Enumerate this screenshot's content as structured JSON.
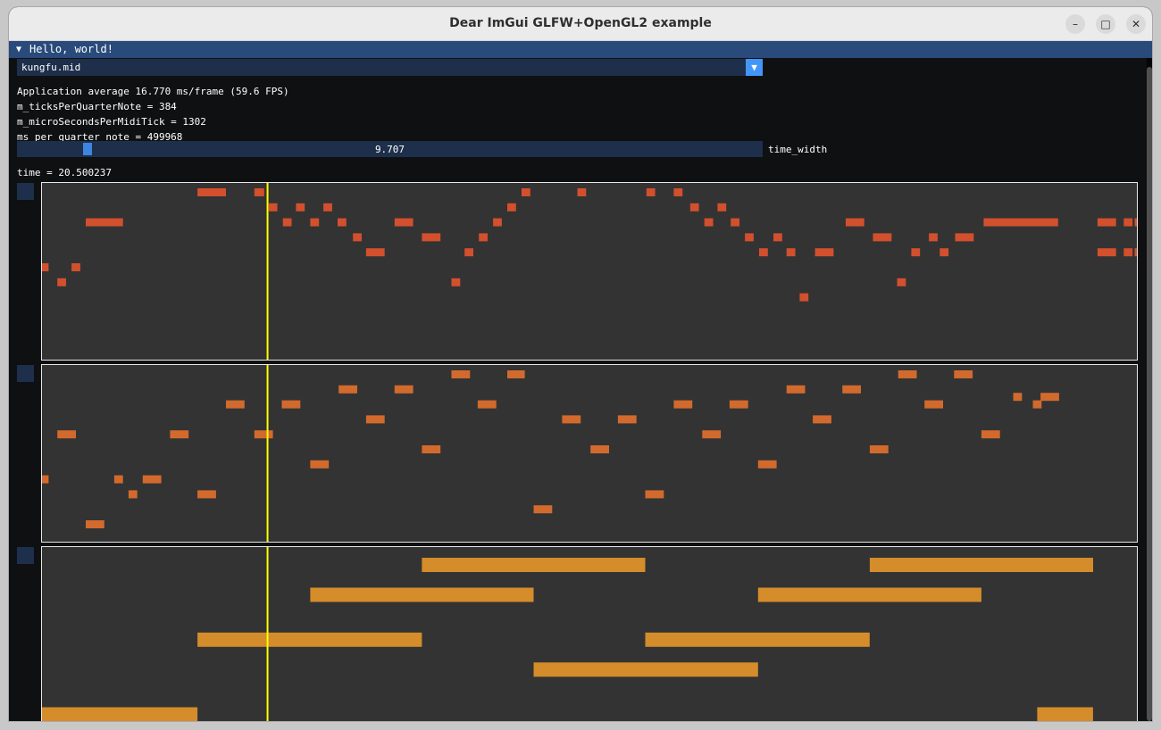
{
  "window": {
    "title": "Dear ImGui GLFW+OpenGL2 example",
    "controls": [
      "minimize-icon",
      "maximize-icon",
      "close-icon"
    ]
  },
  "imgui": {
    "window_title": "Hello, world!",
    "combo_value": "kungfu.mid",
    "stats": [
      "Application average 16.770 ms/frame (59.6 FPS)",
      "m_ticksPerQuarterNote = 384",
      "m_microSecondsPerMidiTick = 1302",
      "ms per quarter note = 499968"
    ],
    "slider": {
      "value_text": "9.707",
      "label": "time_width",
      "fraction": 0.09
    },
    "time_text": "time = 20.500237"
  },
  "colors": {
    "track1": "#d2502d",
    "track2": "#d26a2d",
    "track3": "#d58c2a",
    "playhead": "#ffff00",
    "accent": "#4296fa"
  },
  "playhead_time": 0.206,
  "tracks": [
    {
      "color": "#d2502d",
      "lanes": 11,
      "notes": [
        [
          0.142,
          0.168,
          0
        ],
        [
          0.194,
          0.203,
          0
        ],
        [
          0.438,
          0.446,
          0
        ],
        [
          0.489,
          0.497,
          0
        ],
        [
          0.552,
          0.56,
          0
        ],
        [
          0.577,
          0.585,
          0
        ],
        [
          0.207,
          0.215,
          1
        ],
        [
          0.232,
          0.24,
          1
        ],
        [
          0.257,
          0.265,
          1
        ],
        [
          0.425,
          0.433,
          1
        ],
        [
          0.592,
          0.6,
          1
        ],
        [
          0.617,
          0.625,
          1
        ],
        [
          0.04,
          0.074,
          2
        ],
        [
          0.22,
          0.228,
          2
        ],
        [
          0.245,
          0.253,
          2
        ],
        [
          0.27,
          0.278,
          2
        ],
        [
          0.322,
          0.339,
          2
        ],
        [
          0.412,
          0.42,
          2
        ],
        [
          0.605,
          0.613,
          2
        ],
        [
          0.629,
          0.637,
          2
        ],
        [
          0.734,
          0.751,
          2
        ],
        [
          0.86,
          0.928,
          2
        ],
        [
          0.964,
          0.981,
          2
        ],
        [
          0.988,
          0.996,
          2
        ],
        [
          0.998,
          1.0,
          2
        ],
        [
          0.284,
          0.292,
          3
        ],
        [
          0.347,
          0.364,
          3
        ],
        [
          0.399,
          0.407,
          3
        ],
        [
          0.642,
          0.65,
          3
        ],
        [
          0.668,
          0.676,
          3
        ],
        [
          0.759,
          0.776,
          3
        ],
        [
          0.81,
          0.818,
          3
        ],
        [
          0.834,
          0.851,
          3
        ],
        [
          0.296,
          0.313,
          4
        ],
        [
          0.386,
          0.394,
          4
        ],
        [
          0.655,
          0.663,
          4
        ],
        [
          0.68,
          0.688,
          4
        ],
        [
          0.706,
          0.723,
          4
        ],
        [
          0.794,
          0.802,
          4
        ],
        [
          0.82,
          0.828,
          4
        ],
        [
          0.964,
          0.981,
          4
        ],
        [
          0.988,
          0.996,
          4
        ],
        [
          0.998,
          1.0,
          4
        ],
        [
          0.0,
          0.006,
          5
        ],
        [
          0.027,
          0.035,
          5
        ],
        [
          0.014,
          0.022,
          6
        ],
        [
          0.374,
          0.382,
          6
        ],
        [
          0.781,
          0.789,
          6
        ],
        [
          0.692,
          0.7,
          7
        ]
      ]
    },
    {
      "color": "#d26a2d",
      "lanes": 11,
      "notes": [
        [
          0.374,
          0.391,
          0
        ],
        [
          0.425,
          0.441,
          0
        ],
        [
          0.782,
          0.799,
          0
        ],
        [
          0.833,
          0.85,
          0
        ],
        [
          0.271,
          0.288,
          1
        ],
        [
          0.322,
          0.339,
          1
        ],
        [
          0.68,
          0.697,
          1
        ],
        [
          0.731,
          0.748,
          1
        ],
        [
          0.887,
          0.895,
          1.5
        ],
        [
          0.912,
          0.929,
          1.5
        ],
        [
          0.168,
          0.185,
          2
        ],
        [
          0.219,
          0.236,
          2
        ],
        [
          0.398,
          0.415,
          2
        ],
        [
          0.577,
          0.594,
          2
        ],
        [
          0.628,
          0.645,
          2
        ],
        [
          0.806,
          0.823,
          2
        ],
        [
          0.905,
          0.913,
          2
        ],
        [
          0.296,
          0.313,
          3
        ],
        [
          0.475,
          0.492,
          3
        ],
        [
          0.526,
          0.543,
          3
        ],
        [
          0.704,
          0.721,
          3
        ],
        [
          0.014,
          0.031,
          4
        ],
        [
          0.117,
          0.134,
          4
        ],
        [
          0.194,
          0.211,
          4
        ],
        [
          0.603,
          0.62,
          4
        ],
        [
          0.858,
          0.875,
          4
        ],
        [
          0.347,
          0.364,
          5
        ],
        [
          0.501,
          0.518,
          5
        ],
        [
          0.756,
          0.773,
          5
        ],
        [
          0.245,
          0.262,
          6
        ],
        [
          0.654,
          0.671,
          6
        ],
        [
          0.0,
          0.006,
          7
        ],
        [
          0.066,
          0.074,
          7
        ],
        [
          0.092,
          0.109,
          7
        ],
        [
          0.079,
          0.087,
          8
        ],
        [
          0.142,
          0.159,
          8
        ],
        [
          0.551,
          0.568,
          8
        ],
        [
          0.449,
          0.466,
          9
        ],
        [
          0.04,
          0.057,
          10
        ]
      ]
    },
    {
      "color": "#d58c2a",
      "lanes": 6,
      "notes": [
        [
          0.347,
          0.551,
          0
        ],
        [
          0.756,
          0.96,
          0
        ],
        [
          0.245,
          0.449,
          1
        ],
        [
          0.654,
          0.858,
          1
        ],
        [
          0.142,
          0.347,
          2.5
        ],
        [
          0.551,
          0.756,
          2.5
        ],
        [
          0.449,
          0.654,
          3.5
        ],
        [
          0.0,
          0.142,
          5
        ],
        [
          0.909,
          0.96,
          5
        ]
      ]
    }
  ]
}
